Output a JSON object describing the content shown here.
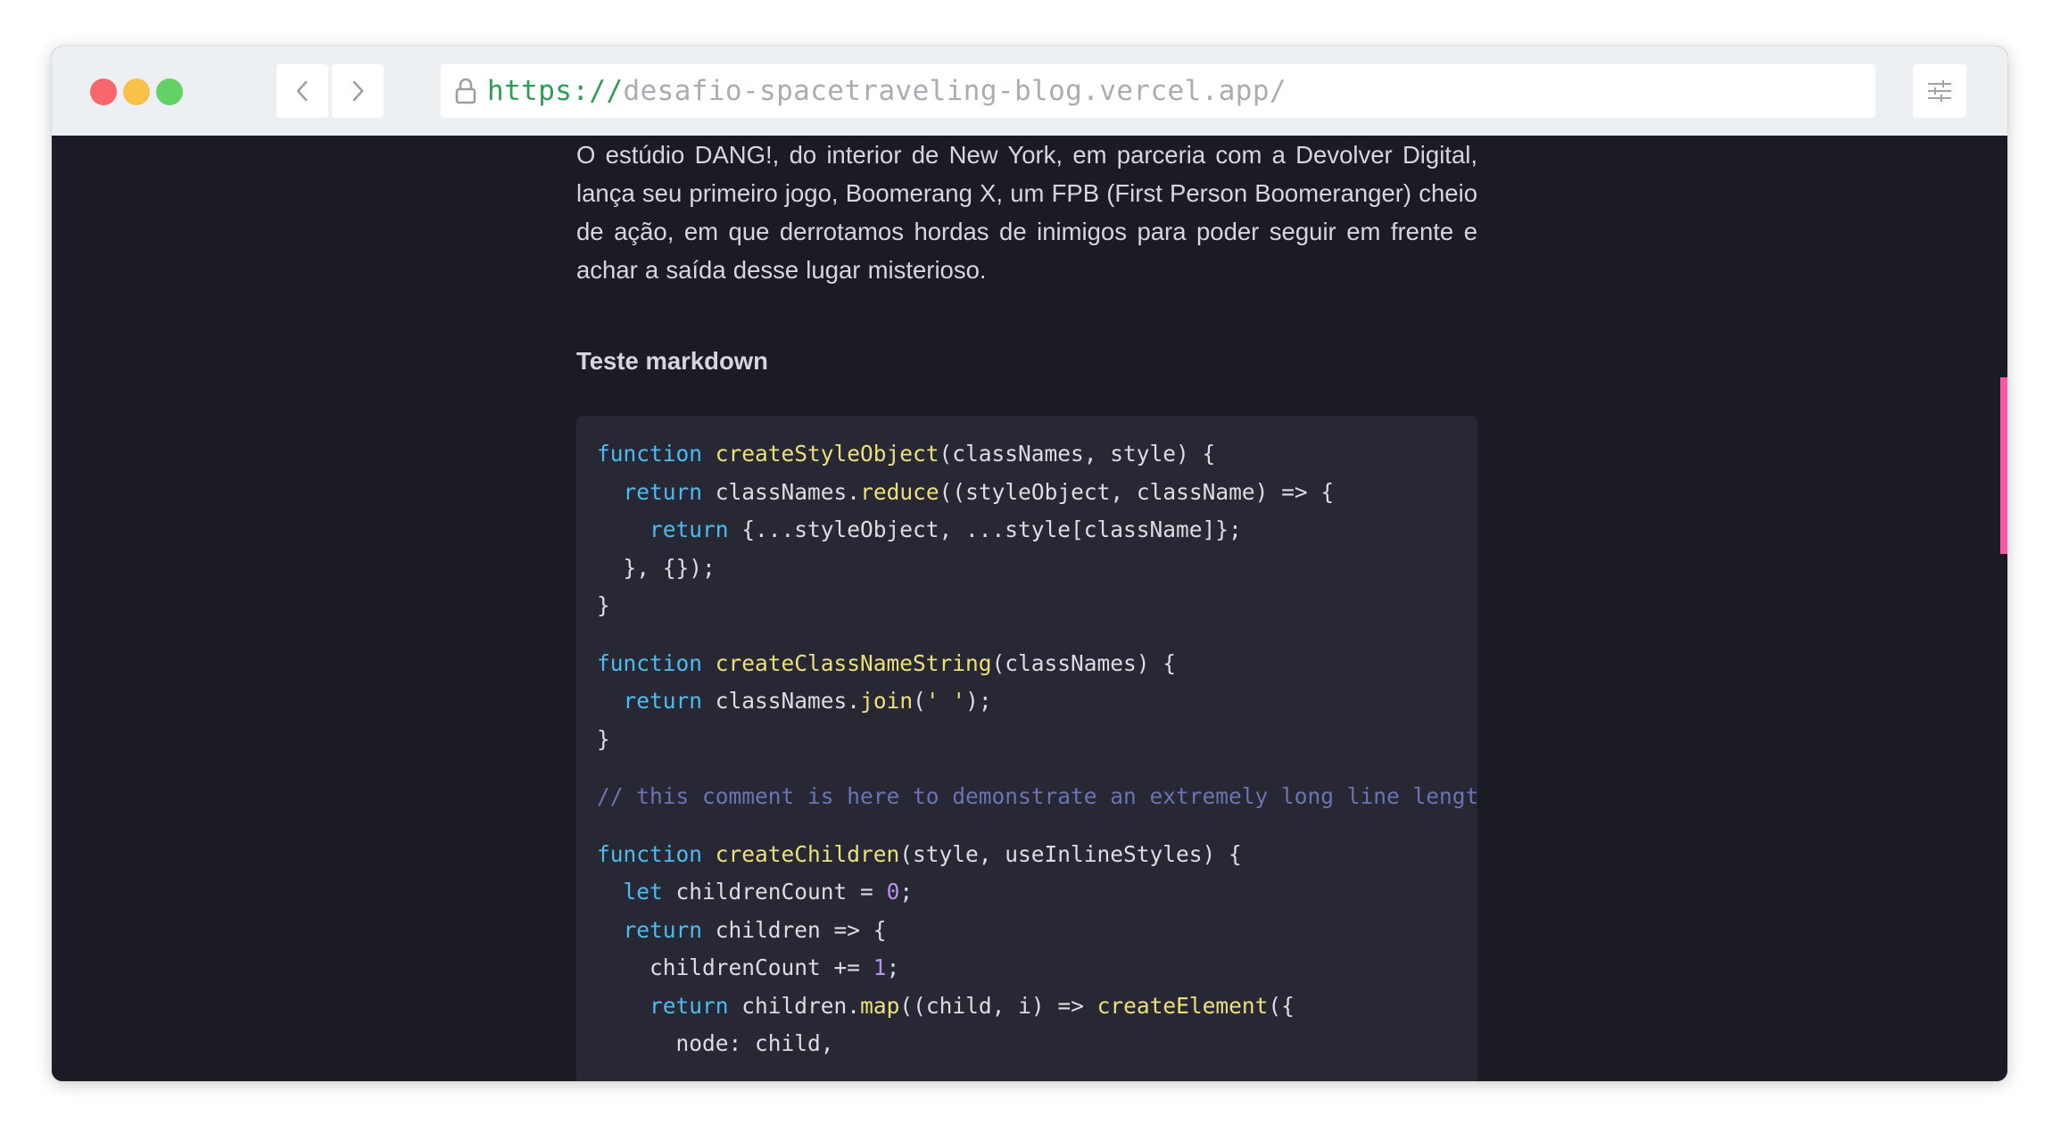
{
  "browser": {
    "url_scheme": "https://",
    "url_host": "desafio-spacetraveling-blog.vercel.app/",
    "icons": [
      "back-arrow-icon",
      "forward-arrow-icon",
      "lock-icon",
      "sliders-icon"
    ]
  },
  "article": {
    "intro_paragraph": "O estúdio DANG!, do interior de New York, em parceria com a Devolver Digital, lança seu primeiro jogo, Boomerang X, um FPB (First Person Boomeranger) cheio de ação, em que derrotamos hordas de inimigos para poder seguir em frente e achar a saída desse lugar misterioso.",
    "section_heading": "Teste markdown",
    "code": {
      "fn1_kw": "function",
      "fn1_name": "createStyleObject",
      "fn1_sig": "(classNames, style) {",
      "fn1_l2_kw": "return",
      "fn1_l2_a": "classNames.",
      "fn1_l2_method": "reduce",
      "fn1_l2_b": "((styleObject, className) => {",
      "fn1_l3_kw": "return",
      "fn1_l3_rest": "{...styleObject, ...style[className]};",
      "fn1_l4": "}, {});",
      "fn1_l5": "}",
      "fn2_kw": "function",
      "fn2_name": "createClassNameString",
      "fn2_sig": "(classNames) {",
      "fn2_l2_kw": "return",
      "fn2_l2_a": "classNames.",
      "fn2_l2_method": "join",
      "fn2_l2_b": "(",
      "fn2_l2_str": "' '",
      "fn2_l2_c": ");",
      "fn2_l3": "}",
      "comment": "// this comment is here to demonstrate an extremely long line length",
      "fn3_kw": "function",
      "fn3_name": "createChildren",
      "fn3_sig": "(style, useInlineStyles) {",
      "fn3_l2_kw": "let",
      "fn3_l2_a": "childrenCount =",
      "fn3_l2_num": "0",
      "fn3_l2_b": ";",
      "fn3_l3_kw": "return",
      "fn3_l3_rest": "children => {",
      "fn3_l4_a": "childrenCount +=",
      "fn3_l4_num": "1",
      "fn3_l4_b": ";",
      "fn3_l5_kw": "return",
      "fn3_l5_a": "children.",
      "fn3_l5_method": "map",
      "fn3_l5_b": "((child, i) =>",
      "fn3_l5_call": "createElement",
      "fn3_l5_c": "({",
      "fn3_l6": "node: child,"
    }
  },
  "colors": {
    "page_background": "#1a1b24",
    "code_background": "#272833",
    "keyword": "#4bbcf2",
    "function_name": "#ece07a",
    "number": "#b993f3",
    "comment": "#6b73b4",
    "scrollbar_thumb": "#ff57a6",
    "url_scheme": "#2e9d55"
  }
}
